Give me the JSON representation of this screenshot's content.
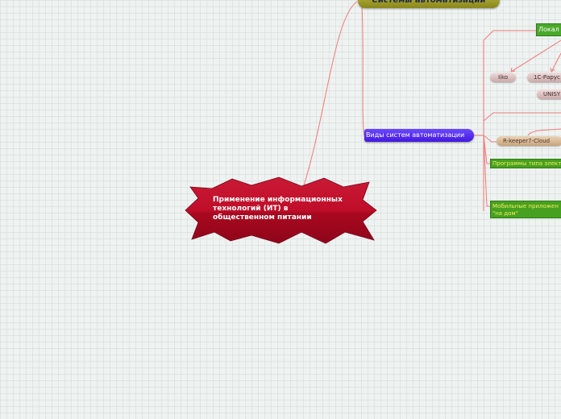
{
  "central_topic": {
    "lines": [
      "Применение информационных",
      "технологий (ИТ) в",
      "общественном питании"
    ],
    "color": "#c0102a"
  },
  "topics": {
    "automation_systems": "Системы автоматизации",
    "automation_types": "Виды систем автоматизации",
    "local": "Локал",
    "iiko": "Iiko",
    "onec": "1С-Рарус",
    "unisys": "UNISY",
    "rkeeper": "R-keeper7-Cloud",
    "electronic": "Программы типа электр",
    "mobile": "Мобильные приложен \"на дом\""
  },
  "colors": {
    "link": "#f07a78",
    "types_fill": "#5a30f0",
    "green_fill": "#48a020",
    "top_fill": "#a8a430"
  }
}
